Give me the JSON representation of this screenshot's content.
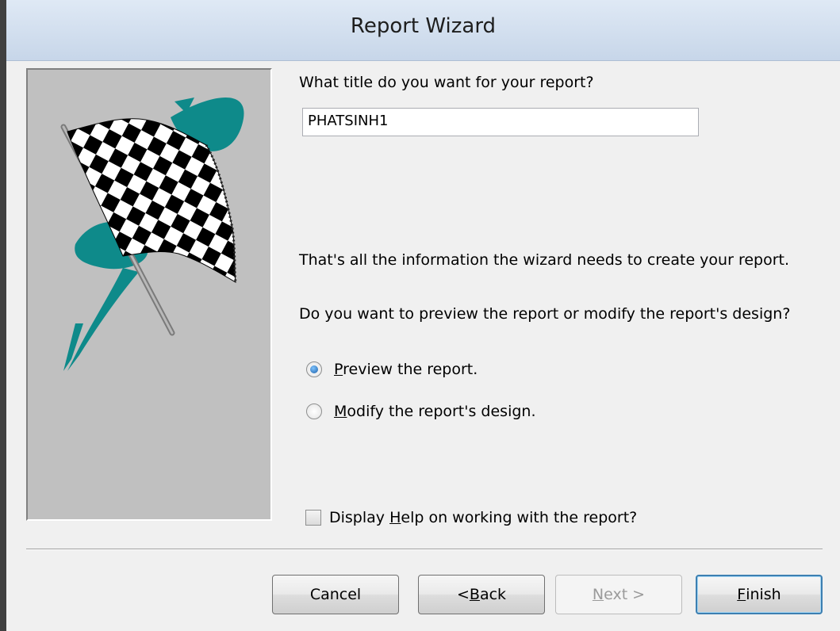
{
  "window": {
    "title": "Report Wizard"
  },
  "icons": {
    "image": "checkered-flag-icon"
  },
  "colors": {
    "accent_teal": "#0e8a8a",
    "title_bar": "#d4e0ef"
  },
  "prompt_title": "What title do you want for your report?",
  "report_title_value": "PHATSINH1",
  "info_text": "That's all the information the wizard needs to create your report.",
  "question_text": "Do you want to preview the report or modify the report's design?",
  "options": [
    {
      "key": "P",
      "rest": "review the report.",
      "checked": true
    },
    {
      "key": "M",
      "rest": "odify the report's design.",
      "checked": false
    }
  ],
  "help_checkbox": {
    "prefix": "Display ",
    "key": "H",
    "rest": "elp on working with the report?",
    "checked": false
  },
  "buttons": {
    "cancel": "Cancel",
    "back_prefix": "< ",
    "back_key": "B",
    "back_rest": "ack",
    "next_key": "N",
    "next_rest": "ext >",
    "finish_key": "F",
    "finish_rest": "inish"
  }
}
